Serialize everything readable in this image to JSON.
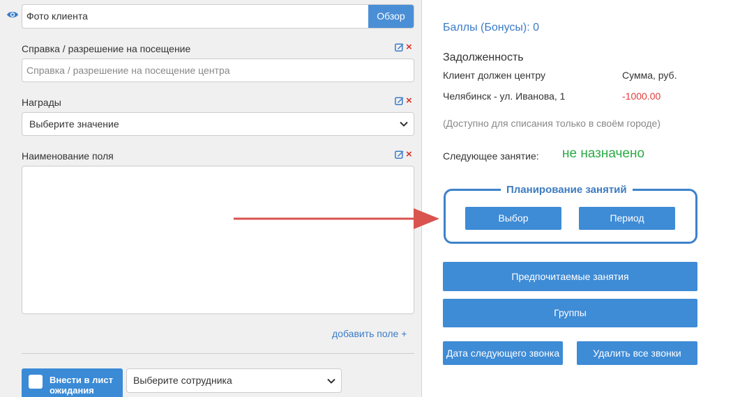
{
  "left": {
    "photo": {
      "value": "Фото клиента",
      "browse_label": "Обзор"
    },
    "certificate": {
      "label": "Справка / разрешение на посещение",
      "placeholder": "Справка / разрешение на посещение центра"
    },
    "awards": {
      "label": "Награды",
      "selected": "Выберите значение"
    },
    "custom_field": {
      "label": "Наименование поля",
      "value": ""
    },
    "add_field_label": "добавить поле +",
    "waitlist": {
      "button_label": "Внести в лист ожидания",
      "employee_selected": "Выберите сотрудника"
    }
  },
  "right": {
    "bonus": "Баллы (Бонусы): 0",
    "debt": {
      "title": "Задолженность",
      "columns": [
        "Клиент должен центру",
        "Сумма, руб."
      ],
      "rows": [
        {
          "center": "Челябинск - ул. Иванова, 1",
          "amount": "-1000.00"
        }
      ],
      "note": "(Доступно для списания только в своём городе)"
    },
    "next_lesson": {
      "label": "Следующее занятие:",
      "value": "не назначено"
    },
    "planning": {
      "title": "Планирование занятий",
      "select_label": "Выбор",
      "period_label": "Период"
    },
    "preferred_label": "Предпочитаемые занятия",
    "groups_label": "Группы",
    "next_call_label": "Дата следующего звонка",
    "delete_calls_label": "Удалить все звонки"
  },
  "colors": {
    "accent": "#3e8bd6",
    "danger": "#e43a3a",
    "success": "#2bab45",
    "arrow": "#d9534f"
  }
}
